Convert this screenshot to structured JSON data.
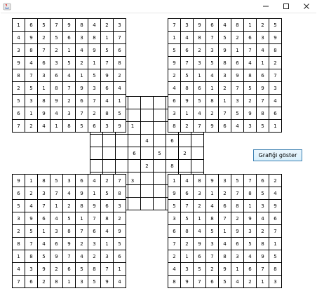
{
  "window": {
    "minimize_glyph": "—",
    "maximize_glyph": "☐",
    "close_glyph": "✕"
  },
  "button_label": "Grafiği göster",
  "grids": [
    {
      "id": "top-left",
      "rows": [
        [
          "1",
          "6",
          "5",
          "7",
          "9",
          "8",
          "4",
          "2",
          "3"
        ],
        [
          "4",
          "9",
          "2",
          "5",
          "6",
          "3",
          "8",
          "1",
          "7"
        ],
        [
          "3",
          "8",
          "7",
          "2",
          "1",
          "4",
          "9",
          "5",
          "6"
        ],
        [
          "9",
          "4",
          "6",
          "3",
          "5",
          "2",
          "1",
          "7",
          "8"
        ],
        [
          "8",
          "7",
          "3",
          "6",
          "4",
          "1",
          "5",
          "9",
          "2"
        ],
        [
          "2",
          "5",
          "1",
          "8",
          "7",
          "9",
          "3",
          "6",
          "4"
        ],
        [
          "5",
          "3",
          "8",
          "9",
          "2",
          "6",
          "7",
          "4",
          "1"
        ],
        [
          "6",
          "1",
          "9",
          "4",
          "3",
          "7",
          "2",
          "8",
          "5"
        ],
        [
          "7",
          "2",
          "4",
          "1",
          "8",
          "5",
          "6",
          "3",
          "9"
        ]
      ]
    },
    {
      "id": "top-right",
      "rows": [
        [
          "7",
          "3",
          "9",
          "6",
          "4",
          "8",
          "1",
          "2",
          "5"
        ],
        [
          "1",
          "4",
          "8",
          "7",
          "5",
          "2",
          "6",
          "3",
          "9"
        ],
        [
          "5",
          "6",
          "2",
          "3",
          "9",
          "1",
          "7",
          "4",
          "8"
        ],
        [
          "9",
          "7",
          "3",
          "5",
          "8",
          "6",
          "4",
          "1",
          "2"
        ],
        [
          "2",
          "5",
          "1",
          "4",
          "3",
          "9",
          "8",
          "6",
          "7"
        ],
        [
          "4",
          "8",
          "6",
          "1",
          "2",
          "7",
          "5",
          "9",
          "3"
        ],
        [
          "6",
          "9",
          "5",
          "8",
          "1",
          "3",
          "2",
          "7",
          "4"
        ],
        [
          "3",
          "1",
          "4",
          "2",
          "7",
          "5",
          "9",
          "8",
          "6"
        ],
        [
          "8",
          "2",
          "7",
          "9",
          "6",
          "4",
          "3",
          "5",
          "1"
        ]
      ]
    },
    {
      "id": "center",
      "rows": [
        [
          "",
          "",
          "",
          "",
          "",
          "",
          "",
          "",
          ""
        ],
        [
          "",
          "",
          "",
          "",
          "",
          "",
          "",
          "",
          ""
        ],
        [
          "",
          "",
          "",
          "",
          "",
          "",
          "",
          "",
          ""
        ],
        [
          "",
          "",
          "",
          "",
          "4",
          "",
          "6",
          "",
          ""
        ],
        [
          "",
          "",
          "",
          "6",
          "",
          "5",
          "",
          "2",
          ""
        ],
        [
          "",
          "",
          "",
          "",
          "2",
          "",
          "8",
          "",
          ""
        ],
        [
          "",
          "",
          "",
          "",
          "",
          "",
          "",
          "",
          ""
        ],
        [
          "",
          "",
          "",
          "",
          "",
          "",
          "",
          "",
          ""
        ],
        [
          "",
          "",
          "",
          "",
          "",
          "",
          "",
          "",
          ""
        ]
      ]
    },
    {
      "id": "bottom-left",
      "rows": [
        [
          "9",
          "1",
          "8",
          "5",
          "3",
          "6",
          "4",
          "2",
          "7"
        ],
        [
          "6",
          "2",
          "3",
          "7",
          "4",
          "9",
          "1",
          "5",
          "8"
        ],
        [
          "5",
          "4",
          "7",
          "1",
          "2",
          "8",
          "9",
          "6",
          "3"
        ],
        [
          "3",
          "9",
          "6",
          "4",
          "5",
          "1",
          "7",
          "8",
          "2"
        ],
        [
          "2",
          "5",
          "1",
          "3",
          "8",
          "7",
          "6",
          "4",
          "9"
        ],
        [
          "8",
          "7",
          "4",
          "6",
          "9",
          "2",
          "3",
          "1",
          "5"
        ],
        [
          "1",
          "8",
          "5",
          "9",
          "7",
          "4",
          "2",
          "3",
          "6"
        ],
        [
          "4",
          "3",
          "9",
          "2",
          "6",
          "5",
          "8",
          "7",
          "1"
        ],
        [
          "7",
          "6",
          "2",
          "8",
          "1",
          "3",
          "5",
          "9",
          "4"
        ]
      ]
    },
    {
      "id": "bottom-right",
      "rows": [
        [
          "1",
          "4",
          "8",
          "9",
          "3",
          "5",
          "7",
          "6",
          "2"
        ],
        [
          "9",
          "6",
          "3",
          "1",
          "2",
          "7",
          "8",
          "5",
          "4"
        ],
        [
          "5",
          "7",
          "2",
          "4",
          "6",
          "8",
          "1",
          "3",
          "9"
        ],
        [
          "3",
          "5",
          "1",
          "8",
          "7",
          "2",
          "9",
          "4",
          "6"
        ],
        [
          "6",
          "8",
          "4",
          "5",
          "1",
          "9",
          "3",
          "2",
          "7"
        ],
        [
          "7",
          "2",
          "9",
          "3",
          "4",
          "6",
          "5",
          "8",
          "1"
        ],
        [
          "2",
          "1",
          "6",
          "7",
          "8",
          "3",
          "4",
          "9",
          "5"
        ],
        [
          "4",
          "3",
          "5",
          "2",
          "9",
          "1",
          "6",
          "7",
          "8"
        ],
        [
          "8",
          "9",
          "7",
          "6",
          "5",
          "4",
          "2",
          "1",
          "3"
        ]
      ]
    }
  ],
  "center_overlap_extras": [
    {
      "grid": "top-left",
      "row": 8,
      "col": 9,
      "value": "1"
    },
    {
      "grid": "bottom-left",
      "row": 0,
      "col": 9,
      "value": "3"
    }
  ]
}
